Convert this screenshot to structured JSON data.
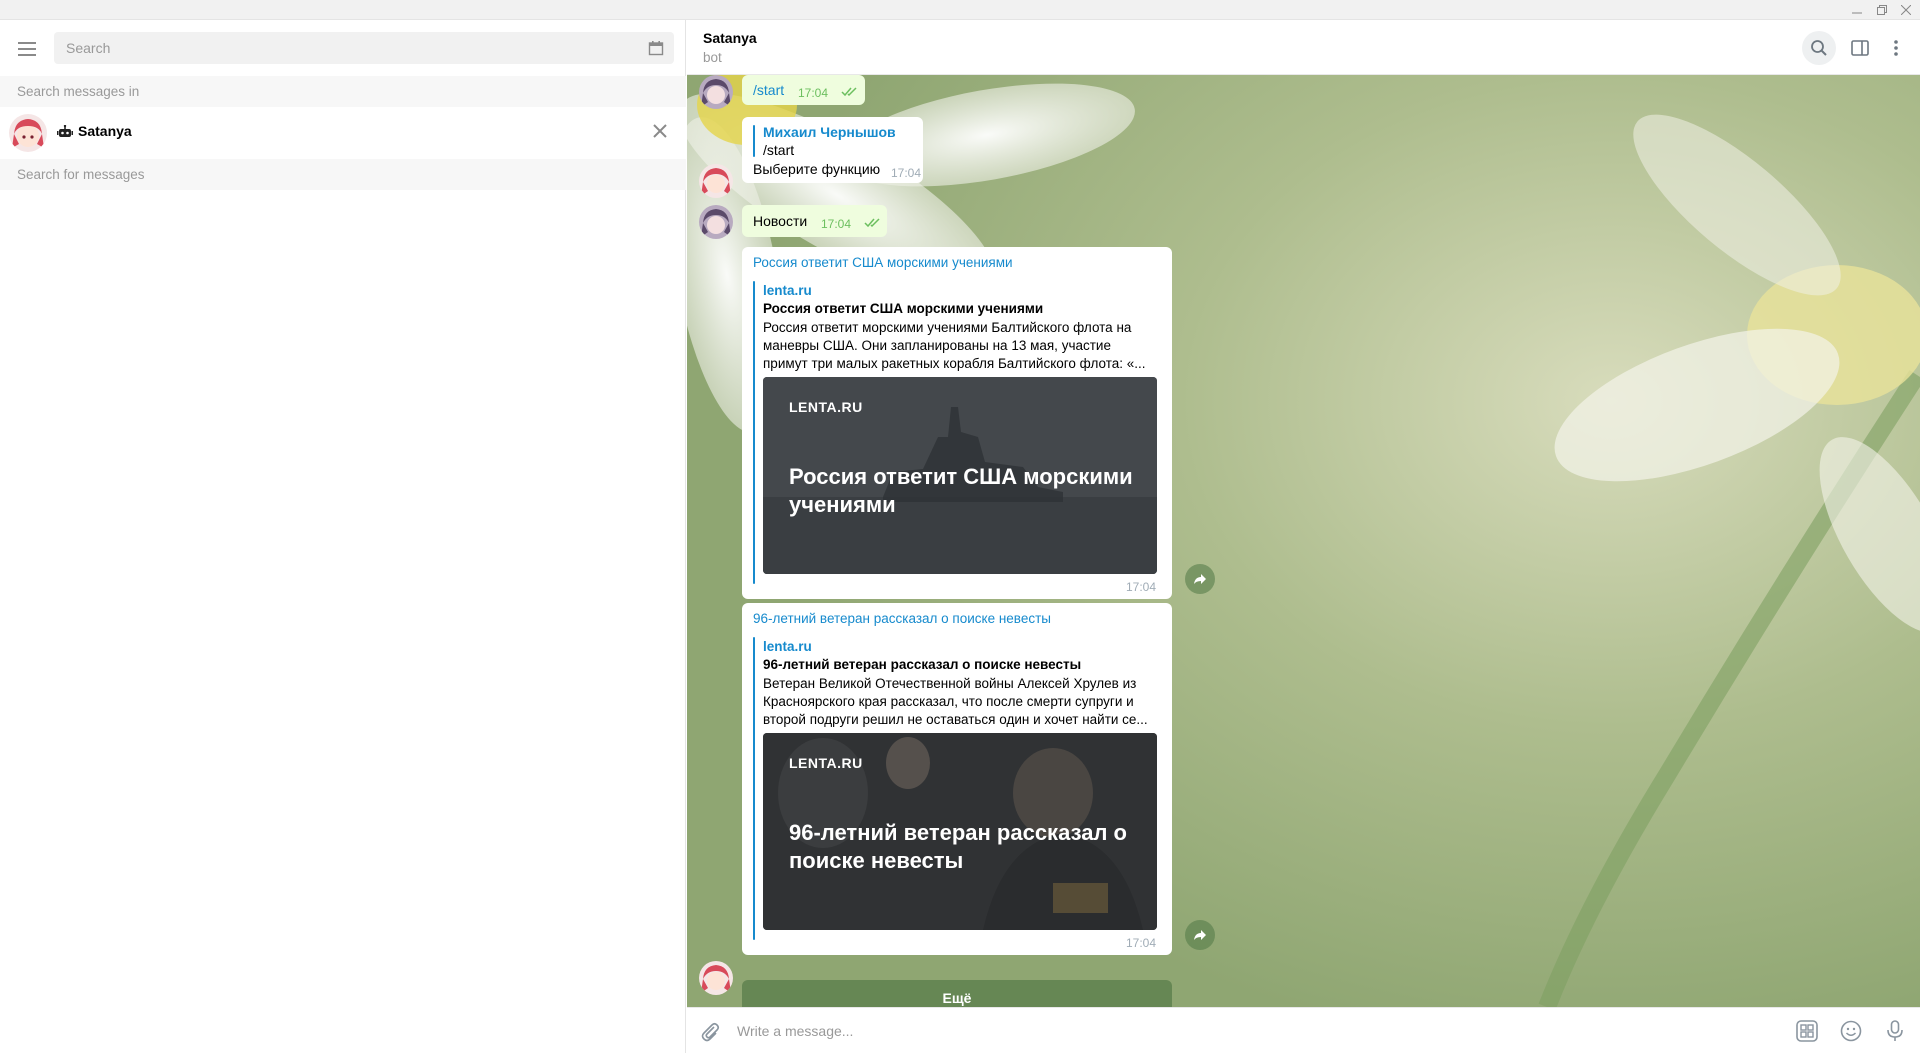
{
  "window": {
    "controls": [
      "minimize-icon",
      "maximize-icon",
      "close-icon"
    ]
  },
  "sidebar": {
    "search_placeholder": "Search",
    "search_messages_in_label": "Search messages in",
    "chat_name": "Satanya",
    "search_for_messages_label": "Search for messages"
  },
  "header": {
    "name": "Satanya",
    "status": "bot"
  },
  "messages": [
    {
      "id": "m1",
      "direction": "out",
      "text": "/start",
      "time": "17:04",
      "read": true
    },
    {
      "id": "m2",
      "direction": "in",
      "reply_to_name": "Михаил Чернышов",
      "reply_to_text": "/start",
      "text": "Выберите функцию",
      "time": "17:04"
    },
    {
      "id": "m3",
      "direction": "out",
      "text": "Новости",
      "time": "17:04",
      "read": true
    },
    {
      "id": "m4",
      "direction": "in",
      "link_text": "Россия ответит США морскими учениями",
      "preview": {
        "site": "lenta.ru",
        "title": "Россия ответит США морскими учениями",
        "desc_lines": [
          "Россия ответит морскими учениями Балтийского флота на",
          "маневры США. Они запланированы на 13 мая, участие",
          "примут три малых ракетных корабля Балтийского флота: «..."
        ],
        "image_brand": "LENTA.RU",
        "image_headline": "Россия ответит США морскими учениями"
      },
      "time": "17:04"
    },
    {
      "id": "m5",
      "direction": "in",
      "link_text": "96-летний ветеран рассказал о поиске невесты",
      "preview": {
        "site": "lenta.ru",
        "title": "96-летний ветеран рассказал о поиске невесты",
        "desc_lines": [
          "Ветеран Великой Отечественной войны Алексей Хрулев из",
          "Красноярского края рассказал, что после смерти супруги и",
          "второй подруги решил не оставаться один и хочет найти се..."
        ],
        "image_brand": "LENTA.RU",
        "image_headline": "96-летний ветеран рассказал о поиске невесты"
      },
      "time": "17:04"
    }
  ],
  "keyboard": {
    "button_label": "Ещё"
  },
  "composer": {
    "placeholder": "Write a message..."
  },
  "colors": {
    "accent": "#168acd",
    "out_bubble": "#effdde",
    "out_time": "#6cbf5f",
    "in_bubble": "#ffffff"
  }
}
